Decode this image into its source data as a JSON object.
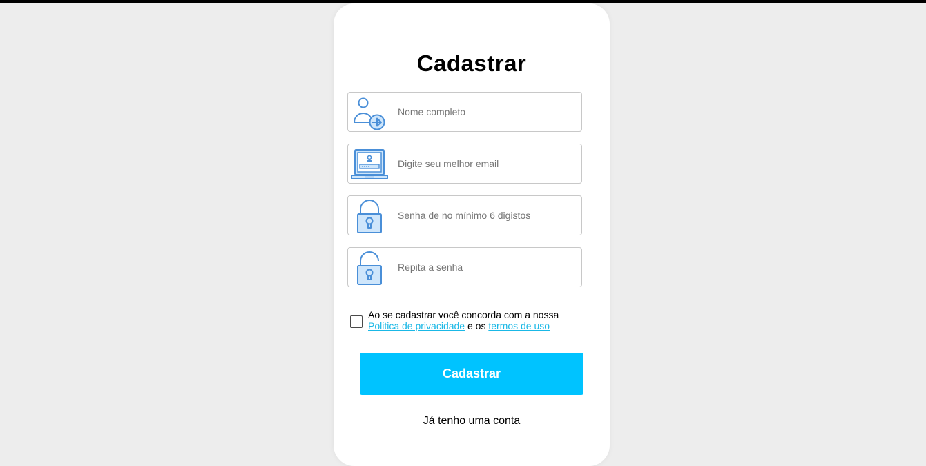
{
  "page": {
    "title": "Cadastrar",
    "background_color": "#ededed",
    "card_color": "#ffffff"
  },
  "form": {
    "fields": [
      {
        "name": "full-name",
        "icon": "user-arrow-icon",
        "placeholder": "Nome completo",
        "value": ""
      },
      {
        "name": "email",
        "icon": "laptop-email-icon",
        "placeholder": "Digite seu melhor email",
        "value": ""
      },
      {
        "name": "password",
        "icon": "lock-icon",
        "placeholder": "Senha de no mínimo 6 digistos",
        "value": ""
      },
      {
        "name": "repeat-password",
        "icon": "unlocked-lock-icon",
        "placeholder": "Repita a senha",
        "value": ""
      }
    ],
    "terms": {
      "checked": false,
      "text_before": "Ao se cadastrar você concorda com a nossa",
      "privacy_link": "Politica de privacidade",
      "text_middle": "e os",
      "terms_link": "termos de uso"
    },
    "submit_label": "Cadastrar",
    "login_link": "Já tenho uma conta"
  },
  "colors": {
    "accent": "#00c3ff",
    "link": "#1ab8e6",
    "icon_stroke": "#4a8fd8",
    "icon_fill": "#cfe6fb"
  }
}
